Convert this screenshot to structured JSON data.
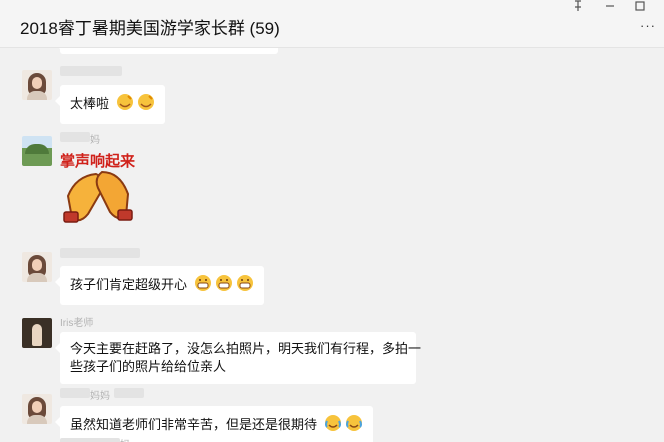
{
  "window": {
    "title": "2018睿丁暑期美国游学家长群 (59)",
    "pin_icon": "pin-icon",
    "restore_icon": "window-restore-icon",
    "more_icon": "more-dots-icon"
  },
  "messages": [
    {
      "text": "太棒啦",
      "emoji": "sly-grin-emoji",
      "emoji_count": 2
    },
    {
      "sticker_text": "掌声响起来",
      "sticker_icon": "clapping-hands-sticker"
    },
    {
      "text": "孩子们肯定超级开心",
      "emoji": "grin-emoji",
      "emoji_count": 3
    },
    {
      "sender_name": "Iris老师",
      "text_line1": "今天主要在赶路了，没怎么拍照片，明天我们有行程，多拍一",
      "text_line2": "些孩子们的照片给给位亲人"
    },
    {
      "sender_suffix": "妈妈",
      "text": "虽然知道老师们非常辛苦，但是还是很期待",
      "emoji": "tear-smile-emoji",
      "emoji_count": 2
    },
    {
      "sender_suffix_top": "妈"
    }
  ]
}
